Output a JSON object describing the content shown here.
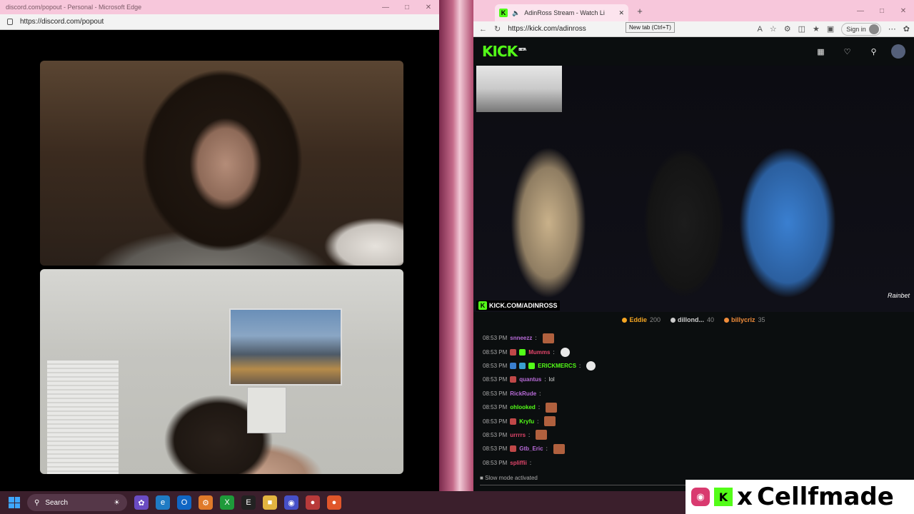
{
  "left_window": {
    "title": "discord.com/popout - Personal - Microsoft Edge",
    "url": "https://discord.com/popout"
  },
  "right_window": {
    "tab_title": "AdinRoss Stream - Watch Li",
    "tooltip": "New tab (Ctrl+T)",
    "url": "https://kick.com/adinross",
    "signin_label": "Sign in"
  },
  "kick": {
    "logo": "KICK",
    "logo_sup": "BETA",
    "stream_tag": "KICK.COM/ADINROSS",
    "sponsor": "Rainbet",
    "gifters": [
      {
        "name": "Eddie",
        "count": "200",
        "color": "#f5a623"
      },
      {
        "name": "dillond...",
        "count": "40",
        "color": "#cccccc"
      },
      {
        "name": "billycriz",
        "count": "35",
        "color": "#f08c3a"
      }
    ]
  },
  "chat": {
    "messages": [
      {
        "time": "08:53 PM",
        "user": "snneezz",
        "color": "#b86bd8",
        "sep": ":",
        "text": "",
        "emote": "face",
        "badges": []
      },
      {
        "time": "08:53 PM",
        "user": "Mumms",
        "color": "#e2456a",
        "sep": ":",
        "text": "",
        "emote": "white",
        "badges": [
          "#c04848",
          "#53fc18"
        ]
      },
      {
        "time": "08:53 PM",
        "user": "ERICKMERCS",
        "color": "#53fc18",
        "sep": ":",
        "text": "",
        "emote": "white",
        "badges": [
          "#3a7fd0",
          "#3a9fd0",
          "#53fc18"
        ]
      },
      {
        "time": "08:53 PM",
        "user": "quantus",
        "color": "#b86bd8",
        "sep": ":",
        "text": "lol",
        "emote": "",
        "badges": [
          "#c04848"
        ]
      },
      {
        "time": "08:53 PM",
        "user": "RickRude",
        "color": "#b86bd8",
        "sep": ":",
        "text": "",
        "emote": "",
        "badges": []
      },
      {
        "time": "08:53 PM",
        "user": "ohlooked",
        "color": "#53fc18",
        "sep": ":",
        "text": "",
        "emote": "face",
        "badges": []
      },
      {
        "time": "08:53 PM",
        "user": "Kryfu",
        "color": "#53fc18",
        "sep": ":",
        "text": "",
        "emote": "face",
        "badges": [
          "#c04848"
        ]
      },
      {
        "time": "08:53 PM",
        "user": "urrrrs",
        "color": "#e2456a",
        "sep": ":",
        "text": "",
        "emote": "face",
        "badges": []
      },
      {
        "time": "08:53 PM",
        "user": "Gtb_Eric",
        "color": "#b86bd8",
        "sep": ":",
        "text": "",
        "emote": "face",
        "badges": [
          "#c04848"
        ]
      },
      {
        "time": "08:53 PM",
        "user": "spliffii",
        "color": "#e2456a",
        "sep": ":",
        "text": "",
        "emote": "",
        "badges": []
      }
    ],
    "slow_mode": "Slow mode activated"
  },
  "taskbar": {
    "search_label": "Search"
  },
  "overlay": {
    "x": "x",
    "handle": "Cellfmade"
  }
}
